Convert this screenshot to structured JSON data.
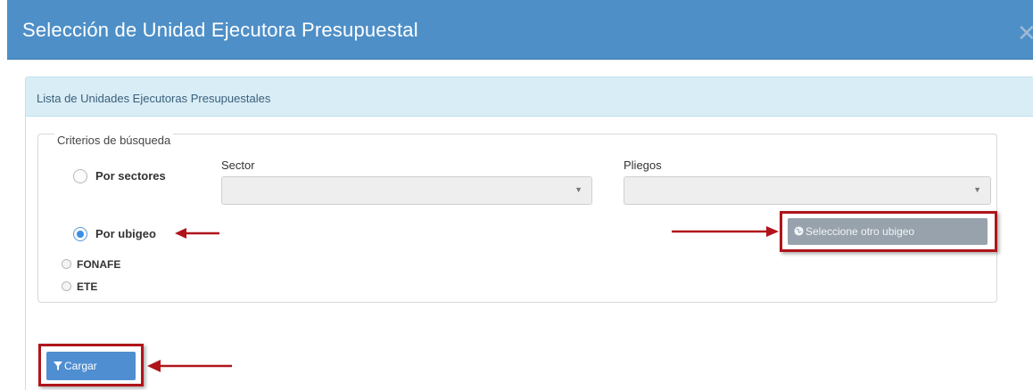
{
  "modal": {
    "title": "Selección de Unidad Ejecutora Presupuestal",
    "close_icon": "close-icon"
  },
  "panel": {
    "title": "Lista de Unidades Ejecutoras Presupuestales"
  },
  "criteria": {
    "legend": "Criterios de búsqueda",
    "options": [
      {
        "label": "Por sectores",
        "checked": false
      },
      {
        "label": "Por ubigeo",
        "checked": true
      },
      {
        "label": "FONAFE",
        "checked": false
      },
      {
        "label": "ETE",
        "checked": false
      }
    ],
    "sector_label": "Sector",
    "sector_value": "",
    "pliegos_label": "Pliegos",
    "pliegos_value": "",
    "select_caret_icon": "caret-down-icon"
  },
  "buttons": {
    "ubigeo_label": "Seleccione otro ubigeo",
    "ubigeo_icon": "globe-icon",
    "cargar_label": "Cargar",
    "cargar_icon": "filter-icon"
  },
  "colors": {
    "header": "#4e8fc7",
    "panel_heading": "#d9edf7",
    "highlight": "#b0141b",
    "button_primary": "#4f8ed0",
    "button_disabled": "#97a2ac"
  }
}
